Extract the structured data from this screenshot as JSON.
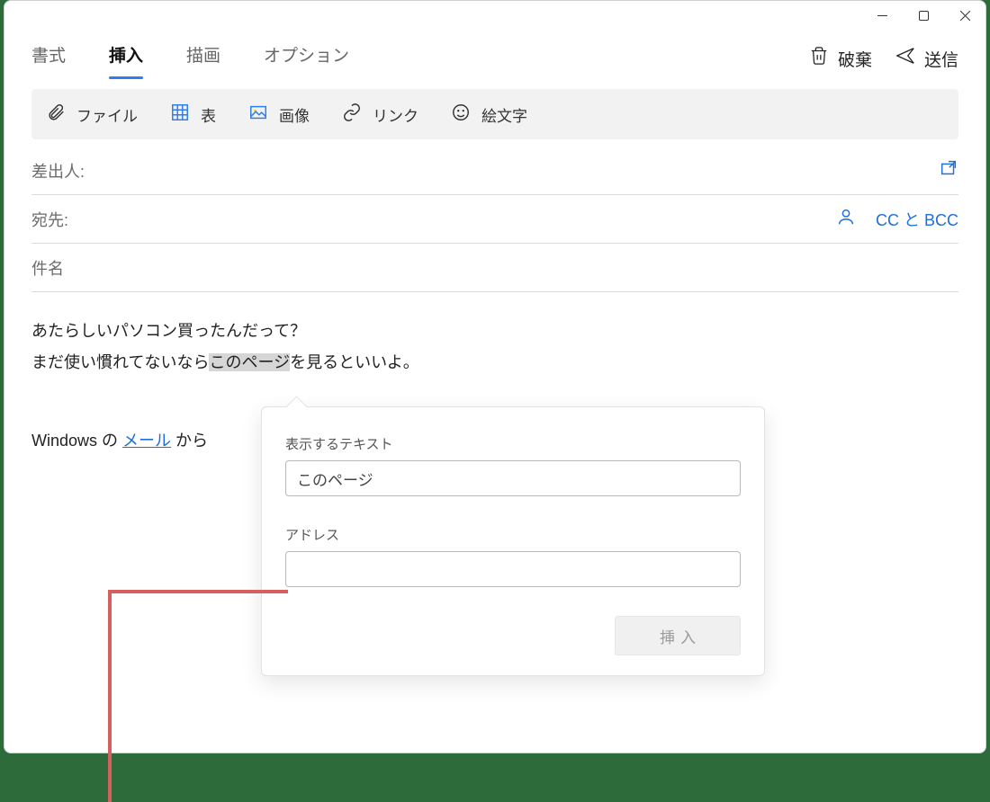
{
  "tabs": {
    "format": "書式",
    "insert": "挿入",
    "draw": "描画",
    "options": "オプション"
  },
  "actions": {
    "discard": "破棄",
    "send": "送信"
  },
  "toolbar": {
    "file": "ファイル",
    "table": "表",
    "image": "画像",
    "link": "リンク",
    "emoji": "絵文字"
  },
  "fields": {
    "from": "差出人:",
    "to": "宛先:",
    "ccbcc": "CC と BCC",
    "subject": "件名"
  },
  "body": {
    "line1": "あたらしいパソコン買ったんだって？",
    "line2a": "まだ使い慣れてないなら",
    "line2_highlight": "このページ",
    "line2b": "を見るといいよ。",
    "sig_pre": "Windows の ",
    "sig_link": "メール",
    "sig_post": " から"
  },
  "popover": {
    "text_label": "表示するテキスト",
    "text_value": "このページ",
    "addr_label": "アドレス",
    "addr_value": "",
    "insert_btn": "挿入"
  }
}
